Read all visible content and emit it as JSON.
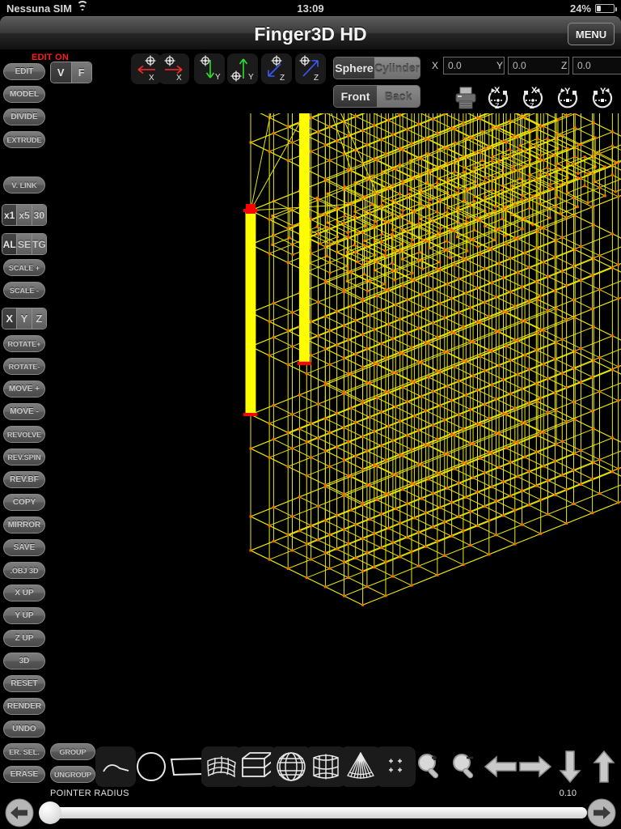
{
  "status_bar": {
    "carrier": "Nessuna SIM",
    "wifi_icon": "wifi-icon",
    "time": "13:09",
    "battery_percent": "24%",
    "battery_level": 24
  },
  "title_bar": {
    "title": "Finger3D HD",
    "menu_label": "MENU"
  },
  "sidebar": {
    "edit_status": "EDIT ON",
    "buttons": [
      {
        "label": "EDIT"
      },
      {
        "label": "MODEL"
      },
      {
        "label": "DIVIDE"
      },
      {
        "label": "EXTRUDE"
      },
      {
        "label": "V. LINK"
      },
      {
        "label": "SCALE +"
      },
      {
        "label": "SCALE -"
      },
      {
        "label": "ROTATE+"
      },
      {
        "label": "ROTATE-"
      },
      {
        "label": "MOVE +"
      },
      {
        "label": "MOVE -"
      },
      {
        "label": "REVOLVE"
      },
      {
        "label": "REV.SPIN"
      },
      {
        "label": "REV.BF"
      },
      {
        "label": "COPY"
      },
      {
        "label": "MIRROR"
      },
      {
        "label": "SAVE"
      },
      {
        "label": ".OBJ 3D"
      },
      {
        "label": "X UP"
      },
      {
        "label": "Y UP"
      },
      {
        "label": "Z UP"
      },
      {
        "label": "3D"
      },
      {
        "label": "RESET"
      },
      {
        "label": "RENDER"
      },
      {
        "label": "UNDO"
      },
      {
        "label": "ER. SEL."
      },
      {
        "label": "ERASE"
      }
    ],
    "group_label": "GROUP",
    "ungroup_label": "UNGROUP",
    "vf_toggle": {
      "options": [
        "V",
        "F"
      ],
      "selected": "V"
    },
    "multiplier_segment": {
      "options": [
        "x1",
        "x5",
        "30"
      ],
      "selected": "x1"
    },
    "select_segment": {
      "options": [
        "AL",
        "SE",
        "TG"
      ],
      "selected": "AL"
    },
    "axis_segment": {
      "options": [
        "X",
        "Y",
        "Z"
      ],
      "selected": "X"
    }
  },
  "top_toolbar": {
    "axis_buttons": [
      {
        "name": "x-minus-icon",
        "axis": "X",
        "direction": "left",
        "color": "#ff2a2a"
      },
      {
        "name": "x-plus-icon",
        "axis": "X",
        "direction": "right",
        "color": "#ff2a2a"
      },
      {
        "name": "y-minus-icon",
        "axis": "Y",
        "direction": "down",
        "color": "#2fe02f"
      },
      {
        "name": "y-plus-icon",
        "axis": "Y",
        "direction": "up",
        "color": "#2fe02f"
      },
      {
        "name": "z-minus-icon",
        "axis": "Z",
        "direction": "down-left",
        "color": "#3a5cff"
      },
      {
        "name": "z-plus-icon",
        "axis": "Z",
        "direction": "up-right",
        "color": "#3a5cff"
      }
    ],
    "shape_toggle": {
      "options": [
        "Sphere",
        "Cylinder"
      ],
      "selected": "Sphere"
    },
    "face_toggle": {
      "options": [
        "Front",
        "Back"
      ],
      "selected": "Front"
    },
    "coords": [
      {
        "label": "X",
        "value": "0.0",
        "placeholder": "0.0"
      },
      {
        "label": "Y",
        "value": "0.0",
        "placeholder": "0.0"
      },
      {
        "label": "Z",
        "value": "0.0",
        "placeholder": "0.0"
      }
    ],
    "print_icon": "printer-icon",
    "dials": [
      {
        "name": "rotate-xz-ccw-dial-icon",
        "top": "X",
        "bottom": "Z",
        "dir": "ccw"
      },
      {
        "name": "rotate-xz-cw-dial-icon",
        "top": "X",
        "bottom": "Z",
        "dir": "cw"
      },
      {
        "name": "rotate-y-ccw-dial-icon",
        "top": "Y",
        "bottom": "",
        "dir": "ccw"
      },
      {
        "name": "rotate-y-cw-dial-icon",
        "top": "Y",
        "bottom": "",
        "dir": "cw"
      }
    ]
  },
  "bottom_toolbar": {
    "tools": [
      {
        "name": "curve-tool-icon"
      },
      {
        "name": "circle-tool-icon"
      },
      {
        "name": "plane-tool-icon"
      },
      {
        "name": "mesh-grid-tool-icon"
      },
      {
        "name": "box-tool-icon"
      },
      {
        "name": "sphere-tool-icon"
      },
      {
        "name": "cylinder-tool-icon"
      },
      {
        "name": "cone-tool-icon"
      },
      {
        "name": "points-tool-icon"
      },
      {
        "name": "zoom-in-icon"
      },
      {
        "name": "zoom-out-icon"
      },
      {
        "name": "pan-left-icon"
      },
      {
        "name": "pan-right-icon"
      },
      {
        "name": "pan-down-icon"
      },
      {
        "name": "pan-up-icon"
      }
    ]
  },
  "pointer_radius": {
    "label": "POINTER RADIUS",
    "value": "0.10",
    "slider_fraction": 0.0,
    "prev_icon": "arrow-left-icon",
    "next_icon": "arrow-right-icon"
  },
  "viewport": {
    "background_color": "#000000",
    "wireframe_color": "#e8e800",
    "vertex_color": "#ff6600",
    "selected_color": "#ffff00",
    "selected_vertex_color": "#ff0000",
    "description": "3D wireframe building model, isometric view, multi-story slab structure with two highlighted vertical columns"
  }
}
